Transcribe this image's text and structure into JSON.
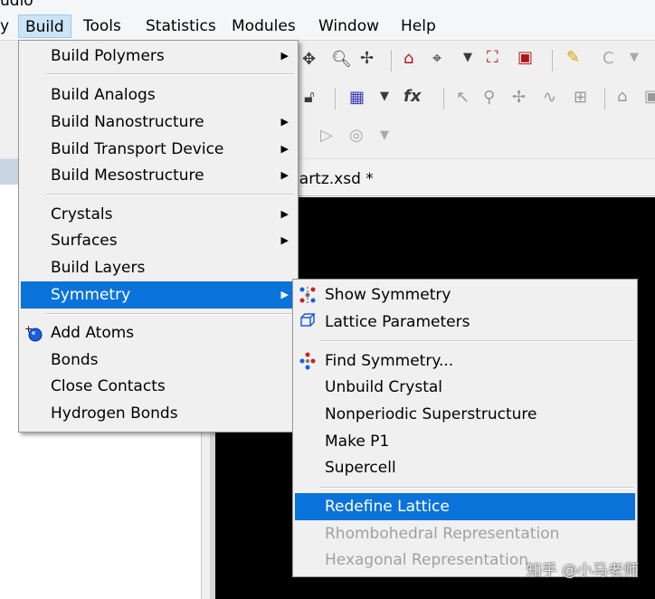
{
  "app_title_fragment": "udio",
  "menubar": [
    {
      "id": "y",
      "label": "y"
    },
    {
      "id": "build",
      "label": "Build"
    },
    {
      "id": "tools",
      "label": "Tools"
    },
    {
      "id": "statistics",
      "label": "Statistics"
    },
    {
      "id": "modules",
      "label": "Modules"
    },
    {
      "id": "window",
      "label": "Window"
    },
    {
      "id": "help",
      "label": "Help"
    }
  ],
  "document_tab": "uartz.xsd *",
  "build_menu": {
    "items": [
      {
        "label": "Build Polymers",
        "submenu": true
      },
      {
        "label": "Build Analogs",
        "submenu": false
      },
      {
        "label": "Build Nanostructure",
        "submenu": true
      },
      {
        "label": "Build Transport Device",
        "submenu": true
      },
      {
        "label": "Build Mesostructure",
        "submenu": true
      },
      {
        "label": "Crystals",
        "submenu": true
      },
      {
        "label": "Surfaces",
        "submenu": true
      },
      {
        "label": "Build Layers",
        "submenu": false
      },
      {
        "label": "Symmetry",
        "submenu": true,
        "highlighted": true
      },
      {
        "label": "Add Atoms",
        "icon": "add-atoms-icon"
      },
      {
        "label": "Bonds"
      },
      {
        "label": "Close Contacts"
      },
      {
        "label": "Hydrogen Bonds"
      }
    ]
  },
  "symmetry_menu": {
    "items": [
      {
        "label": "Show Symmetry",
        "icon": "show-symmetry-icon"
      },
      {
        "label": "Lattice Parameters",
        "icon": "lattice-parameters-icon"
      },
      {
        "label": "Find Symmetry...",
        "icon": "find-symmetry-icon"
      },
      {
        "label": "Unbuild Crystal"
      },
      {
        "label": "Nonperiodic Superstructure"
      },
      {
        "label": "Make P1"
      },
      {
        "label": "Supercell"
      },
      {
        "label": "Redefine Lattice",
        "highlighted": true
      },
      {
        "label": "Rhombohedral Representation",
        "disabled": true
      },
      {
        "label": "Hexagonal Representation",
        "disabled": true
      }
    ]
  },
  "toolbar_icons": {
    "fx_label": "fx",
    "c_label": "C"
  },
  "watermark": "知乎 @小马老师",
  "colors": {
    "highlight": "#0a73d9",
    "menubar_active": "#cce4f7",
    "canvas": "#000000"
  }
}
